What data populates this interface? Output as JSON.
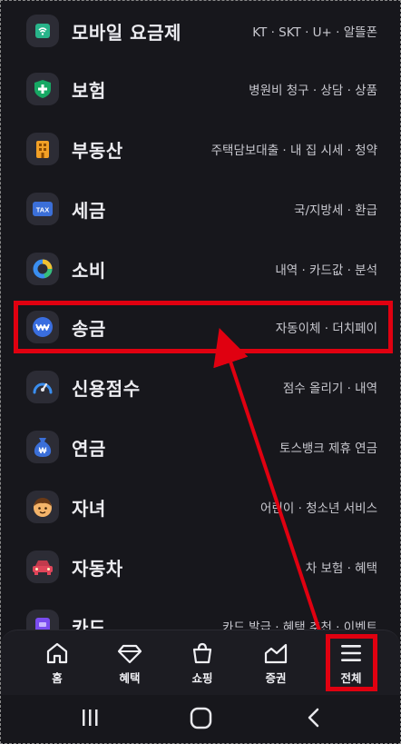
{
  "menu": {
    "items": [
      {
        "label": "모바일 요금제",
        "sub": "KT · SKT · U+ · 알뜰폰",
        "icon": "wifi-icon"
      },
      {
        "label": "보험",
        "sub": "병원비 청구 · 상담 · 상품",
        "icon": "insurance-shield-icon"
      },
      {
        "label": "부동산",
        "sub": "주택담보대출 · 내 집 시세 · 청약",
        "icon": "building-icon"
      },
      {
        "label": "세금",
        "sub": "국/지방세 · 환급",
        "icon": "tax-icon"
      },
      {
        "label": "소비",
        "sub": "내역 · 카드값 · 분석",
        "icon": "donut-chart-icon"
      },
      {
        "label": "송금",
        "sub": "자동이체 · 더치페이",
        "icon": "won-coin-icon"
      },
      {
        "label": "신용점수",
        "sub": "점수 올리기 · 내역",
        "icon": "gauge-icon"
      },
      {
        "label": "연금",
        "sub": "토스뱅크 제휴 연금",
        "icon": "money-bag-icon"
      },
      {
        "label": "자녀",
        "sub": "어린이 · 청소년 서비스",
        "icon": "child-face-icon"
      },
      {
        "label": "자동차",
        "sub": "차 보험 · 혜택",
        "icon": "car-icon"
      },
      {
        "label": "카드",
        "sub": "카드 발급 · 혜택 추천 · 이벤트",
        "icon": "card-icon"
      }
    ]
  },
  "tabbar": {
    "tabs": [
      {
        "label": "홈",
        "icon": "home-icon"
      },
      {
        "label": "혜택",
        "icon": "gem-icon"
      },
      {
        "label": "쇼핑",
        "icon": "shopping-bag-icon"
      },
      {
        "label": "증권",
        "icon": "stock-chart-icon"
      },
      {
        "label": "전체",
        "icon": "hamburger-menu-icon"
      }
    ]
  },
  "colors": {
    "background": "#17171c",
    "highlight": "#e00010",
    "tax_blue": "#3b6fd8",
    "insurance_green": "#17a864",
    "building_orange": "#f2a026",
    "remit_blue": "#3a6ee0",
    "car_red": "#e0455a",
    "card_purple": "#7a4cf0"
  },
  "icons": {
    "tax_text": "TAX",
    "sysnav": [
      "recent-apps-icon",
      "home-circle-icon",
      "back-icon"
    ]
  }
}
